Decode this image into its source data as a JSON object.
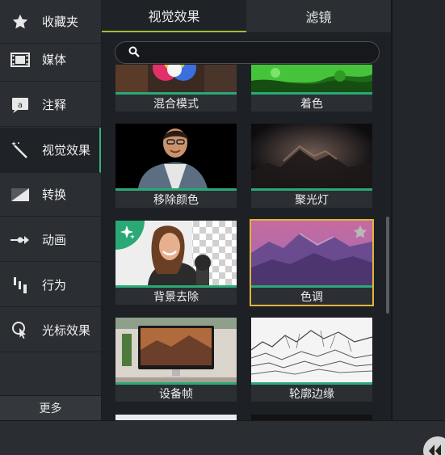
{
  "sidebar": {
    "items": [
      {
        "label": "收藏夹",
        "icon": "star-icon"
      },
      {
        "label": "媒体",
        "icon": "film-icon"
      },
      {
        "label": "注释",
        "icon": "annotation-icon"
      },
      {
        "label": "视觉效果",
        "icon": "magic-wand-icon",
        "active": true
      },
      {
        "label": "转换",
        "icon": "transition-icon"
      },
      {
        "label": "动画",
        "icon": "animation-arrow-icon"
      },
      {
        "label": "行为",
        "icon": "behavior-icon"
      },
      {
        "label": "光标效果",
        "icon": "cursor-effect-icon"
      }
    ],
    "more_label": "更多"
  },
  "tabs": [
    {
      "label": "视觉效果",
      "active": true
    },
    {
      "label": "滤镜",
      "active": false
    }
  ],
  "search": {
    "placeholder": "",
    "value": ""
  },
  "effects": [
    {
      "label": "混合模式"
    },
    {
      "label": "着色"
    },
    {
      "label": "移除颜色"
    },
    {
      "label": "聚光灯"
    },
    {
      "label": "背景去除",
      "badge": "sparkle-icon"
    },
    {
      "label": "色调",
      "selected": true,
      "badge": "favorite-star-icon"
    },
    {
      "label": "设备帧"
    },
    {
      "label": "轮廓边缘"
    }
  ],
  "colors": {
    "accent_green": "#2aa876",
    "tab_underline": "#9cbf3a",
    "selection": "#e0b33a"
  }
}
